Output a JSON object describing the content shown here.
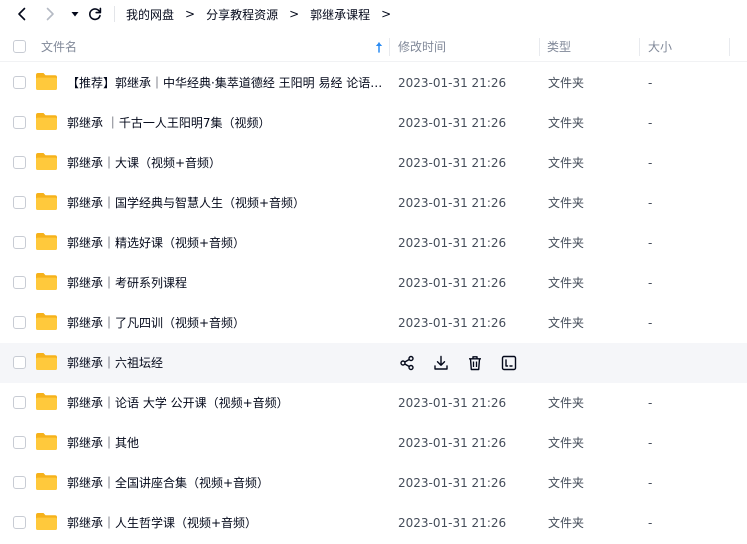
{
  "nav": {
    "back_icon": "chevron-left-icon",
    "forward_icon": "chevron-right-icon",
    "dropdown_icon": "caret-down-icon",
    "refresh_icon": "refresh-icon"
  },
  "breadcrumb": {
    "items": [
      "我的网盘",
      "分享教程资源",
      "郭继承课程"
    ],
    "separator": ">"
  },
  "header": {
    "name": "文件名",
    "modified": "修改时间",
    "type": "类型",
    "size": "大小",
    "sort_icon": "sort-ascending-arrow-icon",
    "sort_color": "#2a8bf2"
  },
  "colors": {
    "folder": "#ffc93c",
    "folder_back": "#f6b21b",
    "hover_row": "#f5f6f9",
    "header_text": "#818999"
  },
  "files": [
    {
      "name": "【推荐】郭继承｜中华经典·集萃道德经 王阳明 易经 论语 ...",
      "modified": "2023-01-31 21:26",
      "type": "文件夹",
      "size": "-"
    },
    {
      "name": "郭继承 ｜千古一人王阳明7集（视频）",
      "modified": "2023-01-31 21:26",
      "type": "文件夹",
      "size": "-"
    },
    {
      "name": "郭继承｜大课（视频+音频）",
      "modified": "2023-01-31 21:26",
      "type": "文件夹",
      "size": "-"
    },
    {
      "name": "郭继承｜国学经典与智慧人生（视频+音频）",
      "modified": "2023-01-31 21:26",
      "type": "文件夹",
      "size": "-"
    },
    {
      "name": "郭继承｜精选好课（视频+音频）",
      "modified": "2023-01-31 21:26",
      "type": "文件夹",
      "size": "-"
    },
    {
      "name": "郭继承｜考研系列课程",
      "modified": "2023-01-31 21:26",
      "type": "文件夹",
      "size": "-"
    },
    {
      "name": "郭继承｜了凡四训（视频+音频）",
      "modified": "2023-01-31 21:26",
      "type": "文件夹",
      "size": "-"
    },
    {
      "name": "郭继承｜六祖坛经",
      "hover": true,
      "actions": [
        "share-icon",
        "download-icon",
        "delete-icon",
        "rename-icon"
      ]
    },
    {
      "name": "郭继承｜论语 大学 公开课（视频+音频）",
      "modified": "2023-01-31 21:26",
      "type": "文件夹",
      "size": "-"
    },
    {
      "name": "郭继承｜其他",
      "modified": "2023-01-31 21:26",
      "type": "文件夹",
      "size": "-"
    },
    {
      "name": "郭继承｜全国讲座合集（视频+音频）",
      "modified": "2023-01-31 21:26",
      "type": "文件夹",
      "size": "-"
    },
    {
      "name": "郭继承｜人生哲学课（视频+音频）",
      "modified": "2023-01-31 21:26",
      "type": "文件夹",
      "size": "-"
    }
  ]
}
